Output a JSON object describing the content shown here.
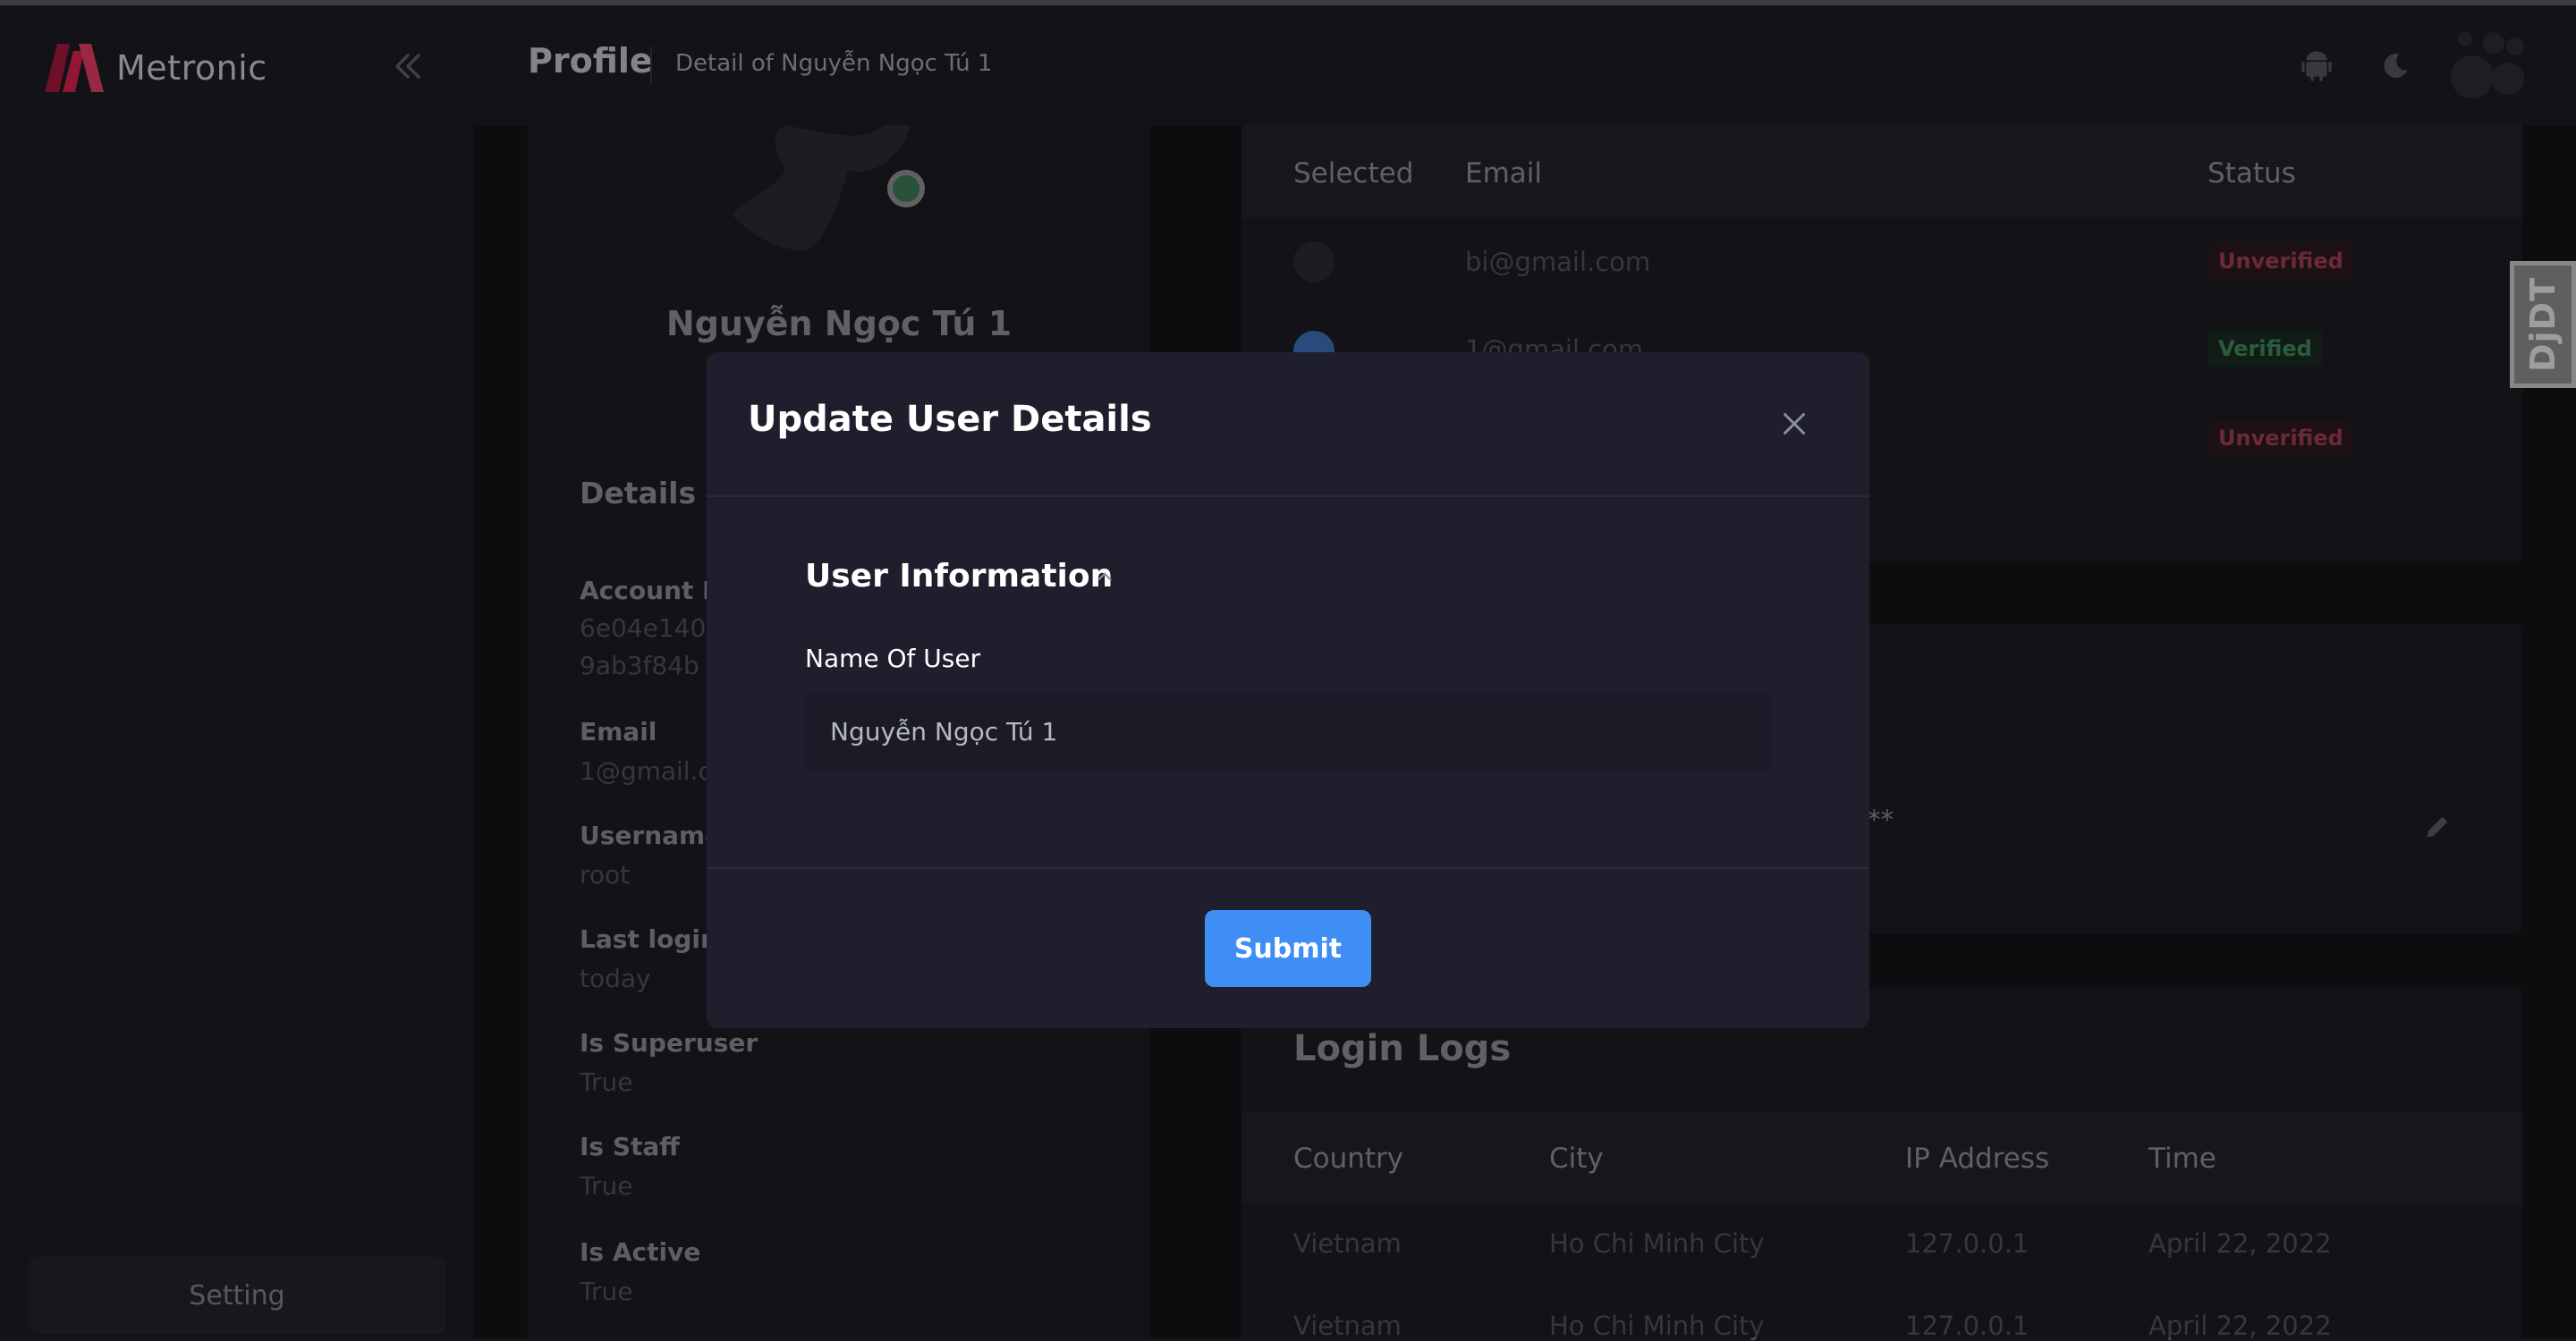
{
  "app": {
    "name": "Metronic",
    "brand_color": "#d9214e"
  },
  "sidebar": {
    "setting_label": "Setting"
  },
  "header": {
    "title": "Profile",
    "subtitle": "Detail of Nguyễn Ngọc Tú 1",
    "icons": [
      "android-icon",
      "moon-icon",
      "user-avatar"
    ]
  },
  "profile": {
    "name": "Nguyễn Ngọc Tú 1",
    "online": true,
    "details_title": "Details",
    "fields": [
      {
        "label": "Account Id",
        "value_line1": "6e04e140-",
        "value_line2": "9ab3f84b"
      },
      {
        "label": "Email",
        "value": "1@gmail.c"
      },
      {
        "label": "Username",
        "value": "root"
      },
      {
        "label": "Last login",
        "value": "today"
      },
      {
        "label": "Is Superuser",
        "value": "True"
      },
      {
        "label": "Is Staff",
        "value": "True"
      },
      {
        "label": "Is Active",
        "value": "True"
      }
    ]
  },
  "emails_table": {
    "headers": {
      "selected": "Selected",
      "email": "Email",
      "status": "Status"
    },
    "rows": [
      {
        "email": "bi@gmail.com",
        "status": "Unverified",
        "selected": false
      },
      {
        "email": "1@gmail.com",
        "status": "Verified",
        "selected": true
      },
      {
        "email": "",
        "status": "Unverified",
        "selected": false
      }
    ],
    "status_colors": {
      "Unverified": "#9e3f50",
      "Verified": "#3f8a5a"
    }
  },
  "password_panel": {
    "masked_suffix": "**"
  },
  "login_logs": {
    "title": "Login Logs",
    "headers": {
      "country": "Country",
      "city": "City",
      "ip": "IP Address",
      "time": "Time"
    },
    "rows": [
      {
        "country": "Vietnam",
        "city": "Ho Chi Minh City",
        "ip": "127.0.0.1",
        "time": "April 22, 2022"
      },
      {
        "country": "Vietnam",
        "city": "Ho Chi Minh City",
        "ip": "127.0.0.1",
        "time": "April 22, 2022"
      }
    ]
  },
  "debug_toolbar": {
    "label": "DjDT"
  },
  "modal": {
    "title": "Update User Details",
    "section_title": "User Information",
    "name_label": "Name Of User",
    "name_value": "Nguyễn Ngọc Tú 1",
    "submit_label": "Submit",
    "submit_color": "#3e8ef5"
  }
}
